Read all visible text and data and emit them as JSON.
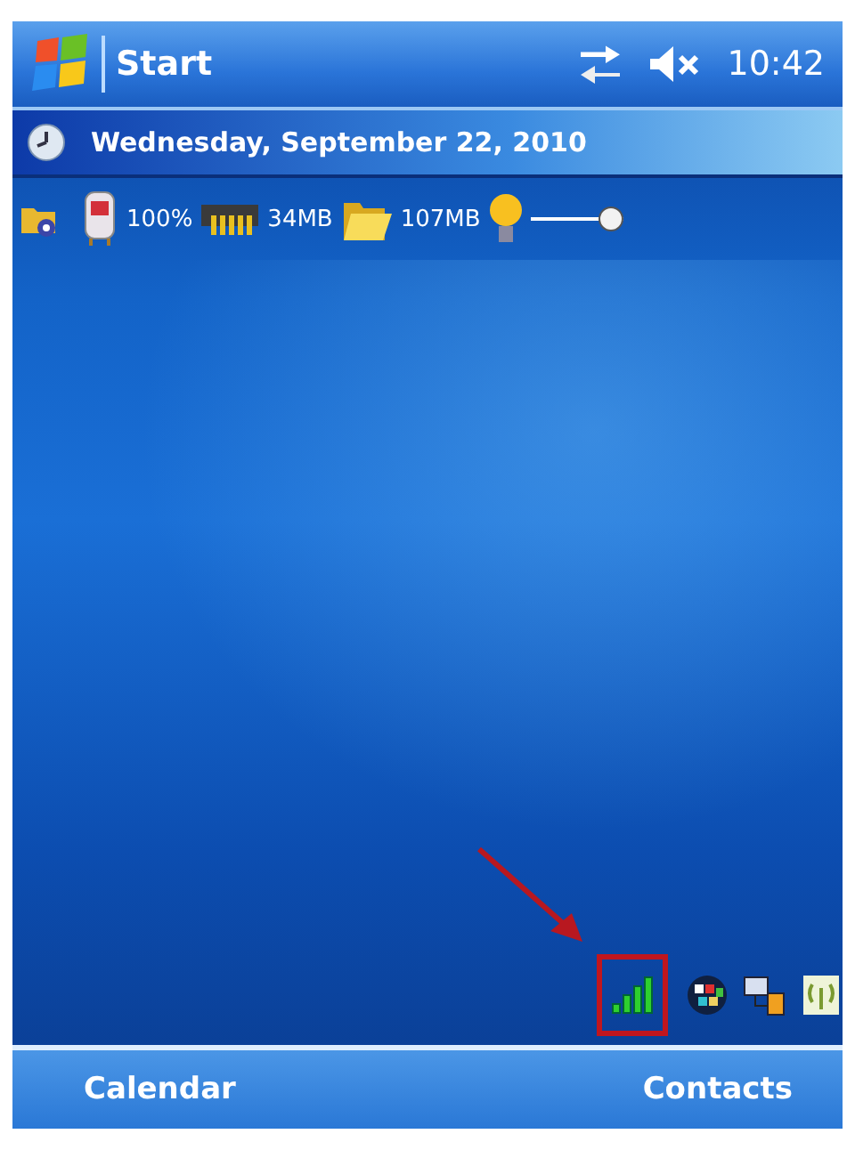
{
  "title_bar": {
    "start_label": "Start",
    "time": "10:42"
  },
  "today": {
    "date": "Wednesday, September 22, 2010"
  },
  "status_row": {
    "battery": "100%",
    "memory": "34MB",
    "storage": "107MB",
    "brightness": {
      "level": 1
    }
  },
  "softkeys": [
    "Calendar",
    "Contacts"
  ]
}
